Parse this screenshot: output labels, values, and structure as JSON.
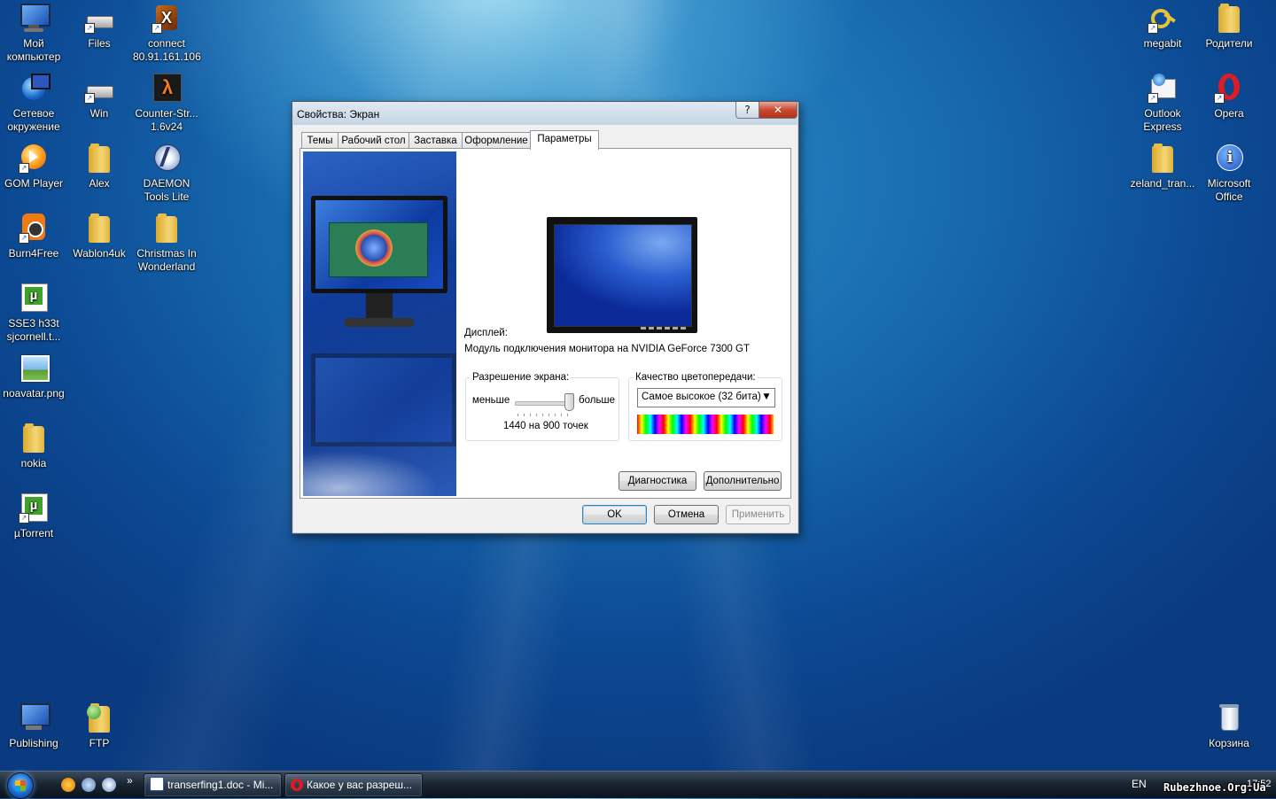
{
  "desktop": {
    "icons_left": [
      {
        "label": "Мой\nкомпьютер",
        "icon": "computer-icon"
      },
      {
        "label": "Files",
        "icon": "drive-icon"
      },
      {
        "label": "connect\n80.91.161.106",
        "icon": "connect-icon"
      },
      {
        "label": "Сетевое\nокружение",
        "icon": "network-icon"
      },
      {
        "label": "Win",
        "icon": "drive-icon"
      },
      {
        "label": "Counter-Str...\n1.6v24",
        "icon": "counter-strike-icon"
      },
      {
        "label": "GOM Player",
        "icon": "gom-player-icon"
      },
      {
        "label": "Alex",
        "icon": "folder-icon"
      },
      {
        "label": "DAEMON\nTools Lite",
        "icon": "daemon-tools-icon"
      },
      {
        "label": "Burn4Free",
        "icon": "burn4free-icon"
      },
      {
        "label": "Wablon4uk",
        "icon": "folder-icon"
      },
      {
        "label": "Christmas In\nWonderland",
        "icon": "folder-icon"
      },
      {
        "label": "SSE3 h33t\nsjcornell.t...",
        "icon": "utorrent-file-icon"
      },
      {
        "label": "noavatar.png",
        "icon": "image-file-icon"
      },
      {
        "label": "nokia",
        "icon": "folder-icon"
      },
      {
        "label": "µTorrent",
        "icon": "utorrent-icon"
      },
      {
        "label": "Publishing",
        "icon": "publishing-icon"
      },
      {
        "label": "FTP",
        "icon": "ftp-icon"
      }
    ],
    "icons_right": [
      {
        "label": "megabit",
        "icon": "key-icon"
      },
      {
        "label": "Родители",
        "icon": "folder-icon"
      },
      {
        "label": "Outlook\nExpress",
        "icon": "outlook-express-icon"
      },
      {
        "label": "Opera",
        "icon": "opera-icon"
      },
      {
        "label": "zeland_tran...",
        "icon": "folder-icon"
      },
      {
        "label": "Microsoft\nOffice",
        "icon": "info-icon"
      },
      {
        "label": "Корзина",
        "icon": "recycle-bin-icon"
      }
    ]
  },
  "dialog": {
    "title": "Свойства: Экран",
    "help_label": "?",
    "close_label": "✕",
    "tabs": [
      {
        "label": "Темы"
      },
      {
        "label": "Рабочий стол"
      },
      {
        "label": "Заставка"
      },
      {
        "label": "Оформление"
      },
      {
        "label": "Параметры",
        "active": true
      }
    ],
    "display_label": "Дисплей:",
    "display_value": "Модуль подключения монитора на NVIDIA GeForce 7300 GT",
    "resolution": {
      "title": "Разрешение экрана:",
      "less": "меньше",
      "more": "больше",
      "value_text": "1440 на 900 точек",
      "slider_level": 1.0
    },
    "color_quality": {
      "title": "Качество цветопередачи:",
      "selected": "Самое высокое (32 бита)"
    },
    "buttons": {
      "diagnostics": "Диагностика",
      "advanced": "Дополнительно",
      "ok": "OK",
      "cancel": "Отмена",
      "apply": "Применить"
    }
  },
  "taskbar": {
    "items": [
      {
        "label": "transerfing1.doc - Mi...",
        "icon": "word-doc-icon"
      },
      {
        "label": "Какое у вас разреш...",
        "icon": "opera-icon"
      }
    ],
    "language": "EN",
    "clock": "17:52",
    "show_more": "»"
  },
  "watermark": "Rubezhnoe.Org.Ua"
}
